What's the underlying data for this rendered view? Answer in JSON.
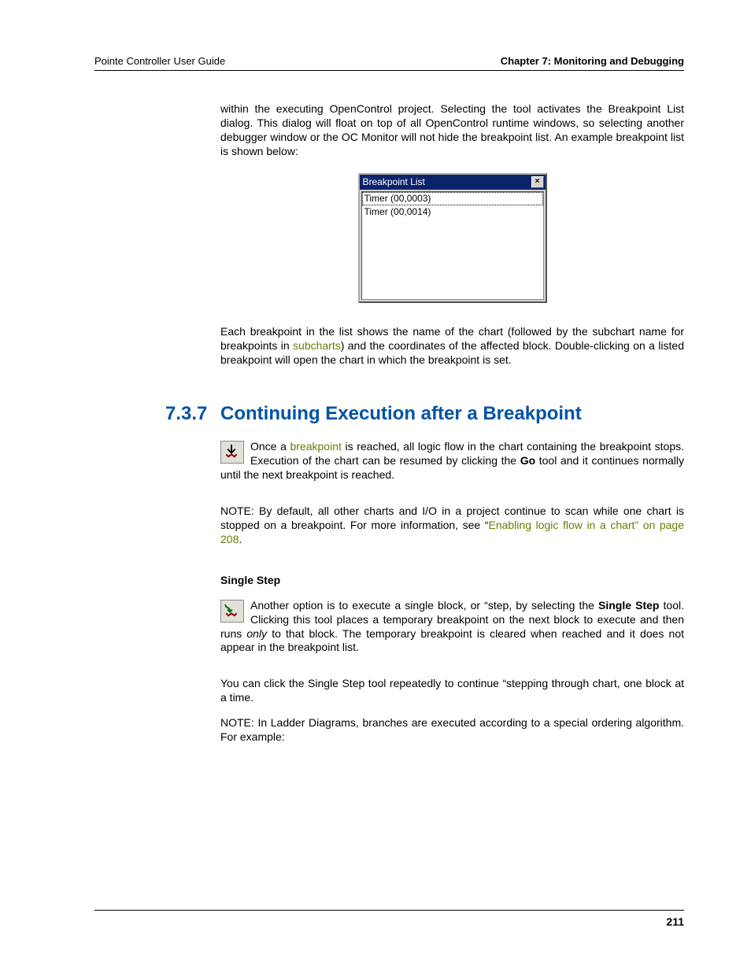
{
  "header": {
    "left": "Pointe Controller User Guide",
    "right": "Chapter 7: Monitoring and Debugging"
  },
  "para1": "within the executing OpenControl project. Selecting the tool activates the Breakpoint List dialog. This dialog will float on top of all OpenControl runtime windows, so selecting another debugger window or the OC Monitor will not hide the breakpoint list. An example breakpoint list is shown below:",
  "dialog": {
    "title": "Breakpoint List",
    "close": "×",
    "items": [
      "Timer (00,0003)",
      "Timer (00,0014)"
    ]
  },
  "para2_a": "Each breakpoint in the list shows the name of the chart (followed by the subchart name for breakpoints in ",
  "para2_link": "subcharts",
  "para2_b": ") and the coordinates of the affected block. Double-clicking on a listed breakpoint will open the chart in which the breakpoint is set.",
  "section": {
    "num": "7.3.7",
    "title": "Continuing Execution after a Breakpoint"
  },
  "para3_a": "Once a ",
  "para3_link": "breakpoint",
  "para3_b": " is reached, all logic flow in the chart containing the breakpoint stops. Execution of the chart can be resumed by clicking the ",
  "para3_go": "Go",
  "para3_c": " tool and it continues normally until the next breakpoint is reached.",
  "para4_a": "NOTE: By default, all other charts and I/O in a project continue to scan while one chart is stopped on a breakpoint. For more information, see “",
  "para4_link": "Enabling logic flow in a chart” on page 208",
  "para4_b": ".",
  "subhead": "Single Step",
  "para5_a": "Another option is to execute a single block, or “step, by selecting the ",
  "para5_bold": "Single Step",
  "para5_b": " tool. Clicking this tool places a temporary breakpoint on the next block to execute and then runs ",
  "para5_em": "only",
  "para5_c": " to that block. The temporary breakpoint is cleared when reached and it does not appear in the breakpoint list.",
  "para6": "You can click the Single Step tool repeatedly to continue “stepping through chart, one block at a time.",
  "para7": "NOTE: In Ladder Diagrams, branches are executed according to a special ordering algorithm. For example:",
  "page_number": "211"
}
